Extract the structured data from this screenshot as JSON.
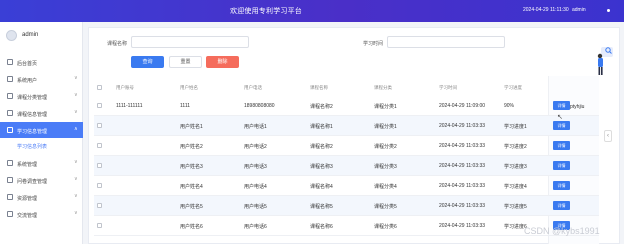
{
  "header": {
    "title": "欢迎使用专利学习平台",
    "datetime": "2024-04-29 11:11:30",
    "user": "admin"
  },
  "sidebar": {
    "username": "admin",
    "items": [
      {
        "label": "后台首页",
        "icon": "home-icon",
        "expandable": false
      },
      {
        "label": "系统用户",
        "icon": "user-icon",
        "expandable": true
      },
      {
        "label": "课程分类管理",
        "icon": "folder-icon",
        "expandable": true
      },
      {
        "label": "课程信息管理",
        "icon": "book-icon",
        "expandable": true
      },
      {
        "label": "学习信息管理",
        "icon": "study-icon",
        "expandable": true,
        "active": true
      },
      {
        "label": "系统管理",
        "icon": "settings-icon",
        "expandable": true
      },
      {
        "label": "问卷调查管理",
        "icon": "survey-icon",
        "expandable": true
      },
      {
        "label": "资源管理",
        "icon": "resource-icon",
        "expandable": true
      },
      {
        "label": "交流管理",
        "icon": "chat-icon",
        "expandable": true
      }
    ],
    "sub_item": "学习信息列表"
  },
  "filters": {
    "course_name_label": "课程名称",
    "study_time_label": "学习时间"
  },
  "buttons": {
    "search": "查询",
    "reset": "重置",
    "delete": "删除"
  },
  "table": {
    "columns": [
      "用户账号",
      "用户姓名",
      "用户电话",
      "课程名称",
      "课程分类",
      "学习时间",
      "学习进度",
      "操作"
    ],
    "rows": [
      [
        "1111-111111",
        "1111",
        "18980808080",
        "课程名称2",
        "课程分类1",
        "2024-04-29 11:09:00",
        "90%"
      ],
      [
        "",
        "用户姓名1",
        "用户电话1",
        "课程名称1",
        "课程分类1",
        "2024-04-29 11:03:33",
        "学习进度1"
      ],
      [
        "",
        "用户姓名2",
        "用户电话2",
        "课程名称2",
        "课程分类2",
        "2024-04-29 11:03:33",
        "学习进度2"
      ],
      [
        "",
        "用户姓名3",
        "用户电话3",
        "课程名称3",
        "课程分类3",
        "2024-04-29 11:03:33",
        "学习进度3"
      ],
      [
        "",
        "用户姓名4",
        "用户电话4",
        "课程名称4",
        "课程分类4",
        "2024-04-29 11:03:33",
        "学习进度4"
      ],
      [
        "",
        "用户姓名5",
        "用户电话5",
        "课程名称5",
        "课程分类5",
        "2024-04-29 11:03:33",
        "学习进度5"
      ],
      [
        "",
        "用户姓名6",
        "用户电话6",
        "课程名称6",
        "课程分类6",
        "2024-04-29 11:03:33",
        "学习进度6"
      ]
    ],
    "detail_label": "详情",
    "tooltip": "ptyhjiu"
  },
  "watermark": "CSDN @kybs1991",
  "colors": {
    "primary": "#3a7af0",
    "danger": "#f56c5c",
    "header": "#3a3fd6"
  }
}
